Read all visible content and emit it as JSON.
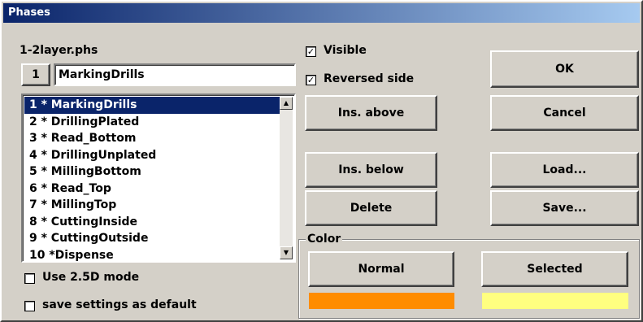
{
  "window": {
    "title": "Phases"
  },
  "file": {
    "name": "1-2layer.phs"
  },
  "phase_editor": {
    "index": "1",
    "name_value": "MarkingDrills"
  },
  "phase_list": {
    "items": [
      {
        "label": "1 * MarkingDrills",
        "selected": true
      },
      {
        "label": "2 * DrillingPlated"
      },
      {
        "label": "3 * Read_Bottom"
      },
      {
        "label": "4 * DrillingUnplated"
      },
      {
        "label": "5 * MillingBottom"
      },
      {
        "label": "6 * Read_Top"
      },
      {
        "label": "7 * MillingTop"
      },
      {
        "label": "8 * CuttingInside"
      },
      {
        "label": "9 * CuttingOutside"
      },
      {
        "label": "10 *Dispense"
      }
    ],
    "scroll_up_icon": "triangle-up",
    "scroll_down_icon": "triangle-down"
  },
  "options": {
    "visible": {
      "label": "Visible",
      "checked": true
    },
    "reversed_side": {
      "label": "Reversed side",
      "checked": true
    },
    "use_25d": {
      "label": "Use 2.5D mode",
      "checked": false
    },
    "save_default": {
      "label": "save settings as default",
      "checked": false
    },
    "check_mark": "✓"
  },
  "buttons": {
    "ok": "OK",
    "cancel": "Cancel",
    "ins_above": "Ins. above",
    "ins_below": "Ins. below",
    "delete": "Delete",
    "load": "Load...",
    "save": "Save..."
  },
  "color_group": {
    "title": "Color",
    "normal_label": "Normal",
    "selected_label": "Selected",
    "normal_color": "#ff8c00",
    "selected_color": "#ffff80"
  }
}
